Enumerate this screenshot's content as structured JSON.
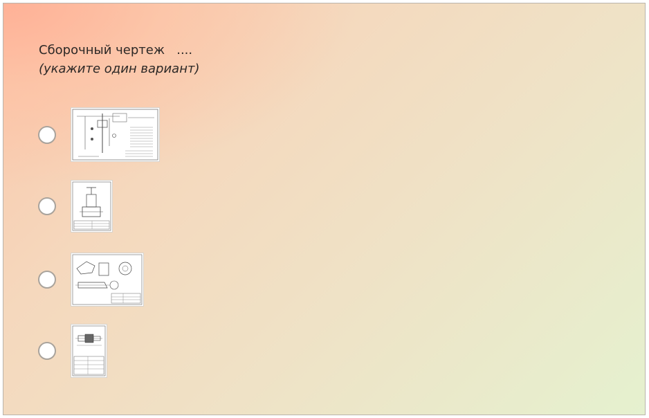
{
  "question": {
    "title": "Сборочный чертеж   ....",
    "hint": "(укажите один вариант)"
  },
  "options": [
    {
      "id": "option-1",
      "selected": false,
      "image": "drawing-thumbnail-schematic"
    },
    {
      "id": "option-2",
      "selected": false,
      "image": "drawing-thumbnail-valve"
    },
    {
      "id": "option-3",
      "selected": false,
      "image": "drawing-thumbnail-assembly"
    },
    {
      "id": "option-4",
      "selected": false,
      "image": "drawing-thumbnail-shaft"
    }
  ]
}
